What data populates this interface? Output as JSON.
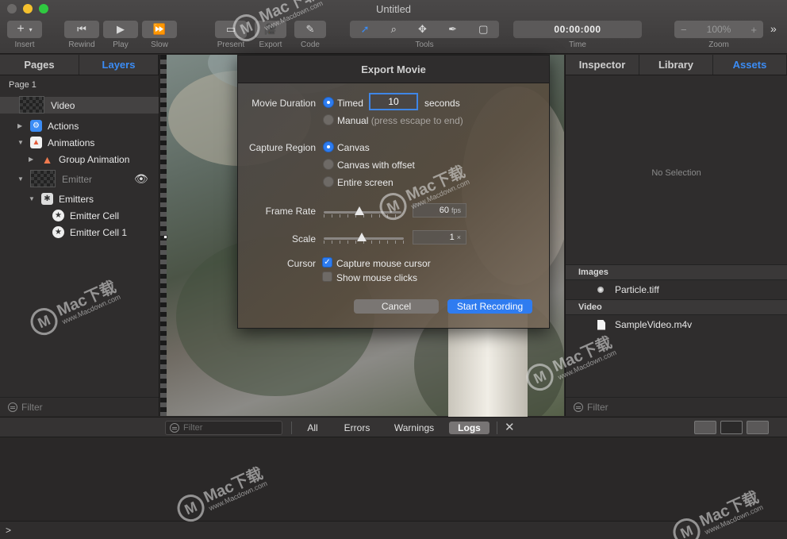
{
  "window": {
    "title": "Untitled"
  },
  "toolbar": {
    "insert_label": "Insert",
    "rewind_label": "Rewind",
    "play_label": "Play",
    "slow_label": "Slow",
    "present_label": "Present",
    "export_label": "Export",
    "code_label": "Code",
    "tools_label": "Tools",
    "time_label": "Time",
    "time_value": "00:00:000",
    "zoom_label": "Zoom",
    "zoom_value": "100%"
  },
  "left_panel": {
    "tabs": [
      {
        "label": "Pages",
        "active": false
      },
      {
        "label": "Layers",
        "active": true
      }
    ],
    "page_label": "Page 1",
    "layers": [
      {
        "label": "Video",
        "icon": "checker-thumbnail",
        "selected": true
      },
      {
        "label": "Actions",
        "icon": "actions-icon"
      },
      {
        "label": "Animations",
        "icon": "animations-icon"
      },
      {
        "label": "Group Animation",
        "icon": "triangle-icon"
      },
      {
        "label": "Emitter",
        "icon": "checker-thumbnail",
        "hidden": true
      },
      {
        "label": "Emitters",
        "icon": "emitters-icon"
      },
      {
        "label": "Emitter Cell",
        "icon": "star-icon"
      },
      {
        "label": "Emitter Cell 1",
        "icon": "star-icon"
      }
    ],
    "filter_placeholder": "Filter"
  },
  "dialog": {
    "title": "Export Movie",
    "movie_duration_label": "Movie Duration",
    "timed_label": "Timed",
    "timed_value": "10",
    "seconds_label": "seconds",
    "manual_label": "Manual",
    "manual_hint": "(press escape to end)",
    "duration_selected": "Timed",
    "capture_region_label": "Capture Region",
    "canvas_label": "Canvas",
    "canvas_offset_label": "Canvas with offset",
    "entire_screen_label": "Entire screen",
    "capture_selected": "Canvas",
    "frame_rate_label": "Frame Rate",
    "frame_rate_value": "60",
    "frame_rate_unit": "fps",
    "scale_label": "Scale",
    "scale_value": "1",
    "scale_unit": "×",
    "cursor_label": "Cursor",
    "capture_mouse_label": "Capture mouse cursor",
    "capture_mouse_checked": true,
    "show_clicks_label": "Show mouse clicks",
    "show_clicks_checked": false,
    "cancel_label": "Cancel",
    "start_label": "Start Recording"
  },
  "right_panel": {
    "tabs": [
      {
        "label": "Inspector",
        "active": false
      },
      {
        "label": "Library",
        "active": false
      },
      {
        "label": "Assets",
        "active": true
      }
    ],
    "no_selection": "No Selection",
    "images_header": "Images",
    "image_asset": "Particle.tiff",
    "video_header": "Video",
    "video_asset": "SampleVideo.m4v",
    "filter_placeholder": "Filter"
  },
  "console": {
    "filter_placeholder": "Filter",
    "tabs": [
      {
        "label": "All",
        "active": false
      },
      {
        "label": "Errors",
        "active": false
      },
      {
        "label": "Warnings",
        "active": false
      },
      {
        "label": "Logs",
        "active": true
      }
    ],
    "prompt": ">"
  },
  "watermark": {
    "brand": "Mac下载",
    "url": "www.Macdown.com"
  },
  "colors": {
    "accent": "#3b8cf5",
    "primary_button": "#2f7cf0"
  }
}
